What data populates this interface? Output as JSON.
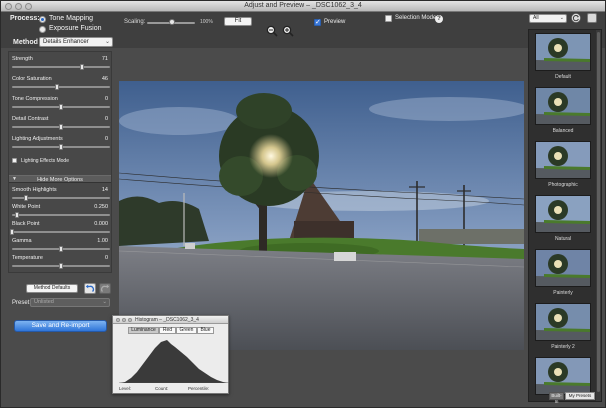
{
  "window": {
    "title": "Adjust and Preview – _DSC1062_3_4"
  },
  "toolbar": {
    "process_label": "Process:",
    "process_options": [
      "Tone Mapping",
      "Exposure Fusion"
    ],
    "process_selected": "Tone Mapping",
    "method_label": "Method",
    "method_value": "Details Enhancer",
    "scaling_label": "Scaling:",
    "scaling_value": "100%",
    "scaling_level": 0.55,
    "fit_label": "Fit",
    "zoom_out_icon": "zoom-out-icon",
    "zoom_in_icon": "zoom-in-icon",
    "preview_label": "Preview",
    "preview_checked": true,
    "selection_mode_label": "Selection Mode",
    "selection_mode_checked": false,
    "help_label": "?",
    "presets_filter_value": "All"
  },
  "sliders": [
    {
      "label": "Strength",
      "value": "71",
      "level": 0.71
    },
    {
      "label": "Color Saturation",
      "value": "46",
      "level": 0.46
    },
    {
      "label": "Tone Compression",
      "value": "0",
      "level": 0.5
    },
    {
      "label": "Detail Contrast",
      "value": "0",
      "level": 0.5
    },
    {
      "label": "Lighting Adjustments",
      "value": "0",
      "level": 0.5
    }
  ],
  "lighting_effects_label": "Lighting Effects Mode",
  "more_options": {
    "toggle_label": "Hide More Options",
    "sliders": [
      {
        "label": "Smooth Highlights",
        "value": "14",
        "level": 0.14
      },
      {
        "label": "White Point",
        "value": "0.250",
        "level": 0.05
      },
      {
        "label": "Black Point",
        "value": "0.000",
        "level": 0.0
      },
      {
        "label": "Gamma",
        "value": "1.00",
        "level": 0.5
      },
      {
        "label": "Temperature",
        "value": "0",
        "level": 0.5
      }
    ]
  },
  "actions": {
    "method_defaults_label": "Method Defaults",
    "preset_label": "Preset:",
    "preset_value": "Unlisted",
    "save_label": "Save and Re-import"
  },
  "histogram": {
    "title": "Histogram – _DSC1062_3_4",
    "tabs": [
      "Luminance",
      "Red",
      "Green",
      "Blue"
    ],
    "active_tab": "Luminance",
    "footer": [
      "Level:",
      "Count:",
      "Percentile:"
    ]
  },
  "presets": {
    "items": [
      "Default",
      "Balanced",
      "Photographic",
      "Natural",
      "Painterly",
      "Painterly 2",
      ""
    ],
    "tabs": [
      "Built-In",
      "My Presets"
    ]
  },
  "colors": {
    "accent": "#2f75d8",
    "panel": "#484848",
    "toolbar": "#3f3f3f"
  }
}
